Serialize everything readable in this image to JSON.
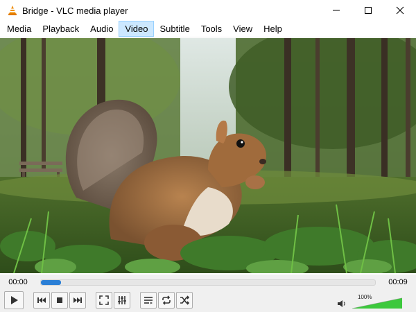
{
  "window": {
    "title": "Bridge - VLC media player"
  },
  "menu": {
    "items": [
      "Media",
      "Playback",
      "Audio",
      "Video",
      "Subtitle",
      "Tools",
      "View",
      "Help"
    ],
    "active_index": 3
  },
  "player": {
    "elapsed": "00:00",
    "remaining": "00:09",
    "progress_fraction": 0.06,
    "volume_label": "100%",
    "volume_fraction": 1.0
  },
  "colors": {
    "seek_fill": "#2b7fd6",
    "volume_fill": "#3cc83c",
    "menu_highlight": "#cce8ff"
  },
  "icons": {
    "app": "vlc-cone-icon",
    "minimize": "minimize-icon",
    "maximize": "maximize-icon",
    "close": "close-icon",
    "play": "play-icon",
    "previous": "previous-icon",
    "stop": "stop-icon",
    "next": "next-icon",
    "fullscreen": "fullscreen-icon",
    "extended_settings": "equalizer-icon",
    "playlist": "playlist-icon",
    "loop": "loop-icon",
    "shuffle": "shuffle-icon",
    "volume": "speaker-icon"
  }
}
